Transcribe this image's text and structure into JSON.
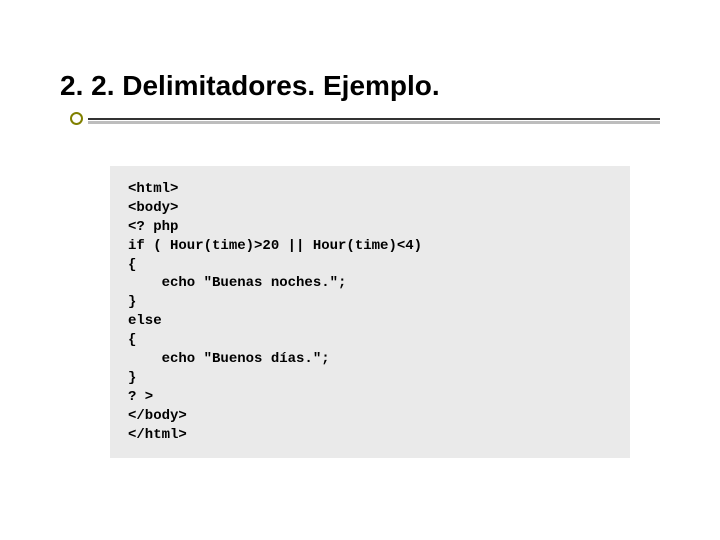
{
  "title": "2. 2. Delimitadores. Ejemplo.",
  "code": "<html>\n<body>\n<? php\nif ( Hour(time)>20 || Hour(time)<4)\n{\n    echo \"Buenas noches.\";\n}\nelse\n{\n    echo \"Buenos días.\";\n}\n? >\n</body>\n</html>"
}
